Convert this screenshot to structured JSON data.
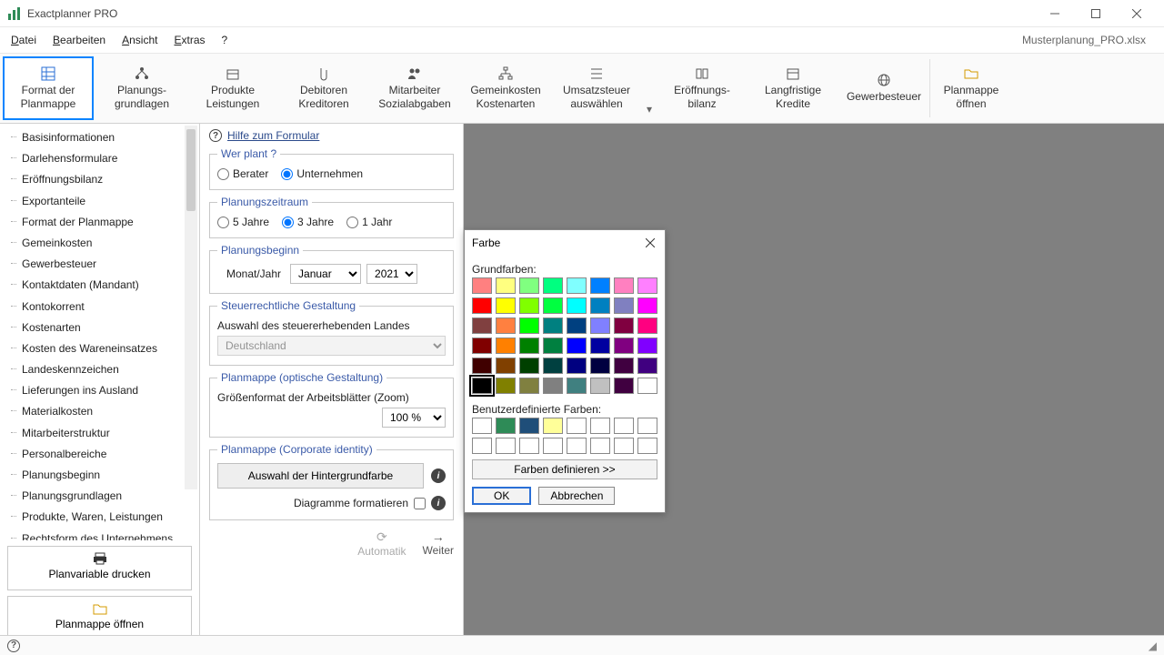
{
  "app": {
    "title": "Exactplanner PRO",
    "document": "Musterplanung_PRO.xlsx"
  },
  "menu": {
    "file": "Datei",
    "edit": "Bearbeiten",
    "view": "Ansicht",
    "extras": "Extras",
    "help": "?"
  },
  "ribbon": {
    "format": "Format der Planmappe",
    "grundlagen": "Planungs-\ngrundlagen",
    "produkte": "Produkte Leistungen",
    "debitoren": "Debitoren Kreditoren",
    "mitarbeiter": "Mitarbeiter Sozialabgaben",
    "gemeinkosten": "Gemeinkosten Kostenarten",
    "umsatzsteuer": "Umsatzsteuer auswählen",
    "eroeffnung": "Eröffnungs-\nbilanz",
    "kredite": "Langfristige Kredite",
    "gewerbe": "Gewerbesteuer",
    "open": "Planmappe öffnen"
  },
  "tree": [
    "Basisinformationen",
    "Darlehensformulare",
    "Eröffnungsbilanz",
    "Exportanteile",
    "Format der Planmappe",
    "Gemeinkosten",
    "Gewerbesteuer",
    "Kontaktdaten (Mandant)",
    "Kontokorrent",
    "Kostenarten",
    "Kosten des Wareneinsatzes",
    "Landeskennzeichen",
    "Lieferungen ins Ausland",
    "Materialkosten",
    "Mitarbeiterstruktur",
    "Personalbereiche",
    "Planungsbeginn",
    "Planungsgrundlagen",
    "Produkte, Waren, Leistungen",
    "Rechtsform des Unternehmens"
  ],
  "sideButtons": {
    "print": "Planvariable drucken",
    "open": "Planmappe öffnen"
  },
  "form": {
    "helpLink": "Hilfe zum Formular",
    "werPlant": {
      "legend": "Wer plant ?",
      "berater": "Berater",
      "unternehmen": "Unternehmen"
    },
    "zeitraum": {
      "legend": "Planungszeitraum",
      "y5": "5 Jahre",
      "y3": "3 Jahre",
      "y1": "1 Jahr"
    },
    "beginn": {
      "legend": "Planungsbeginn",
      "label": "Monat/Jahr",
      "month": "Januar",
      "year": "2021"
    },
    "steuer": {
      "legend": "Steuerrechtliche Gestaltung",
      "label": "Auswahl des steuererhebenden Landes",
      "value": "Deutschland"
    },
    "optisch": {
      "legend": "Planmappe (optische Gestaltung)",
      "label": "Größenformat der Arbeitsblätter (Zoom)",
      "zoom": "100 %"
    },
    "ci": {
      "legend": "Planmappe (Corporate identity)",
      "bgBtn": "Auswahl der Hintergrundfarbe",
      "diag": "Diagramme formatieren"
    },
    "nav": {
      "auto": "Automatik",
      "next": "Weiter"
    }
  },
  "dialog": {
    "title": "Farbe",
    "basicLabel": "Grundfarben:",
    "customLabel": "Benutzerdefinierte Farben:",
    "define": "Farben definieren >>",
    "ok": "OK",
    "cancel": "Abbrechen",
    "basicColors": [
      "#ff8080",
      "#ffff80",
      "#80ff80",
      "#00ff80",
      "#80ffff",
      "#0080ff",
      "#ff80c0",
      "#ff80ff",
      "#ff0000",
      "#ffff00",
      "#80ff00",
      "#00ff40",
      "#00ffff",
      "#0080c0",
      "#8080c0",
      "#ff00ff",
      "#804040",
      "#ff8040",
      "#00ff00",
      "#008080",
      "#004080",
      "#8080ff",
      "#800040",
      "#ff0080",
      "#800000",
      "#ff8000",
      "#008000",
      "#008040",
      "#0000ff",
      "#0000a0",
      "#800080",
      "#8000ff",
      "#400000",
      "#804000",
      "#004000",
      "#004040",
      "#000080",
      "#000040",
      "#400040",
      "#400080",
      "#000000",
      "#808000",
      "#808040",
      "#808080",
      "#408080",
      "#c0c0c0",
      "#400040",
      "#ffffff"
    ],
    "selectedIndex": 40,
    "customColors": [
      "#ffffff",
      "#2e8b57",
      "#1f4e79",
      "#ffff99",
      "#ffffff",
      "#ffffff",
      "#ffffff",
      "#ffffff",
      "#ffffff",
      "#ffffff",
      "#ffffff",
      "#ffffff",
      "#ffffff",
      "#ffffff",
      "#ffffff",
      "#ffffff"
    ]
  }
}
